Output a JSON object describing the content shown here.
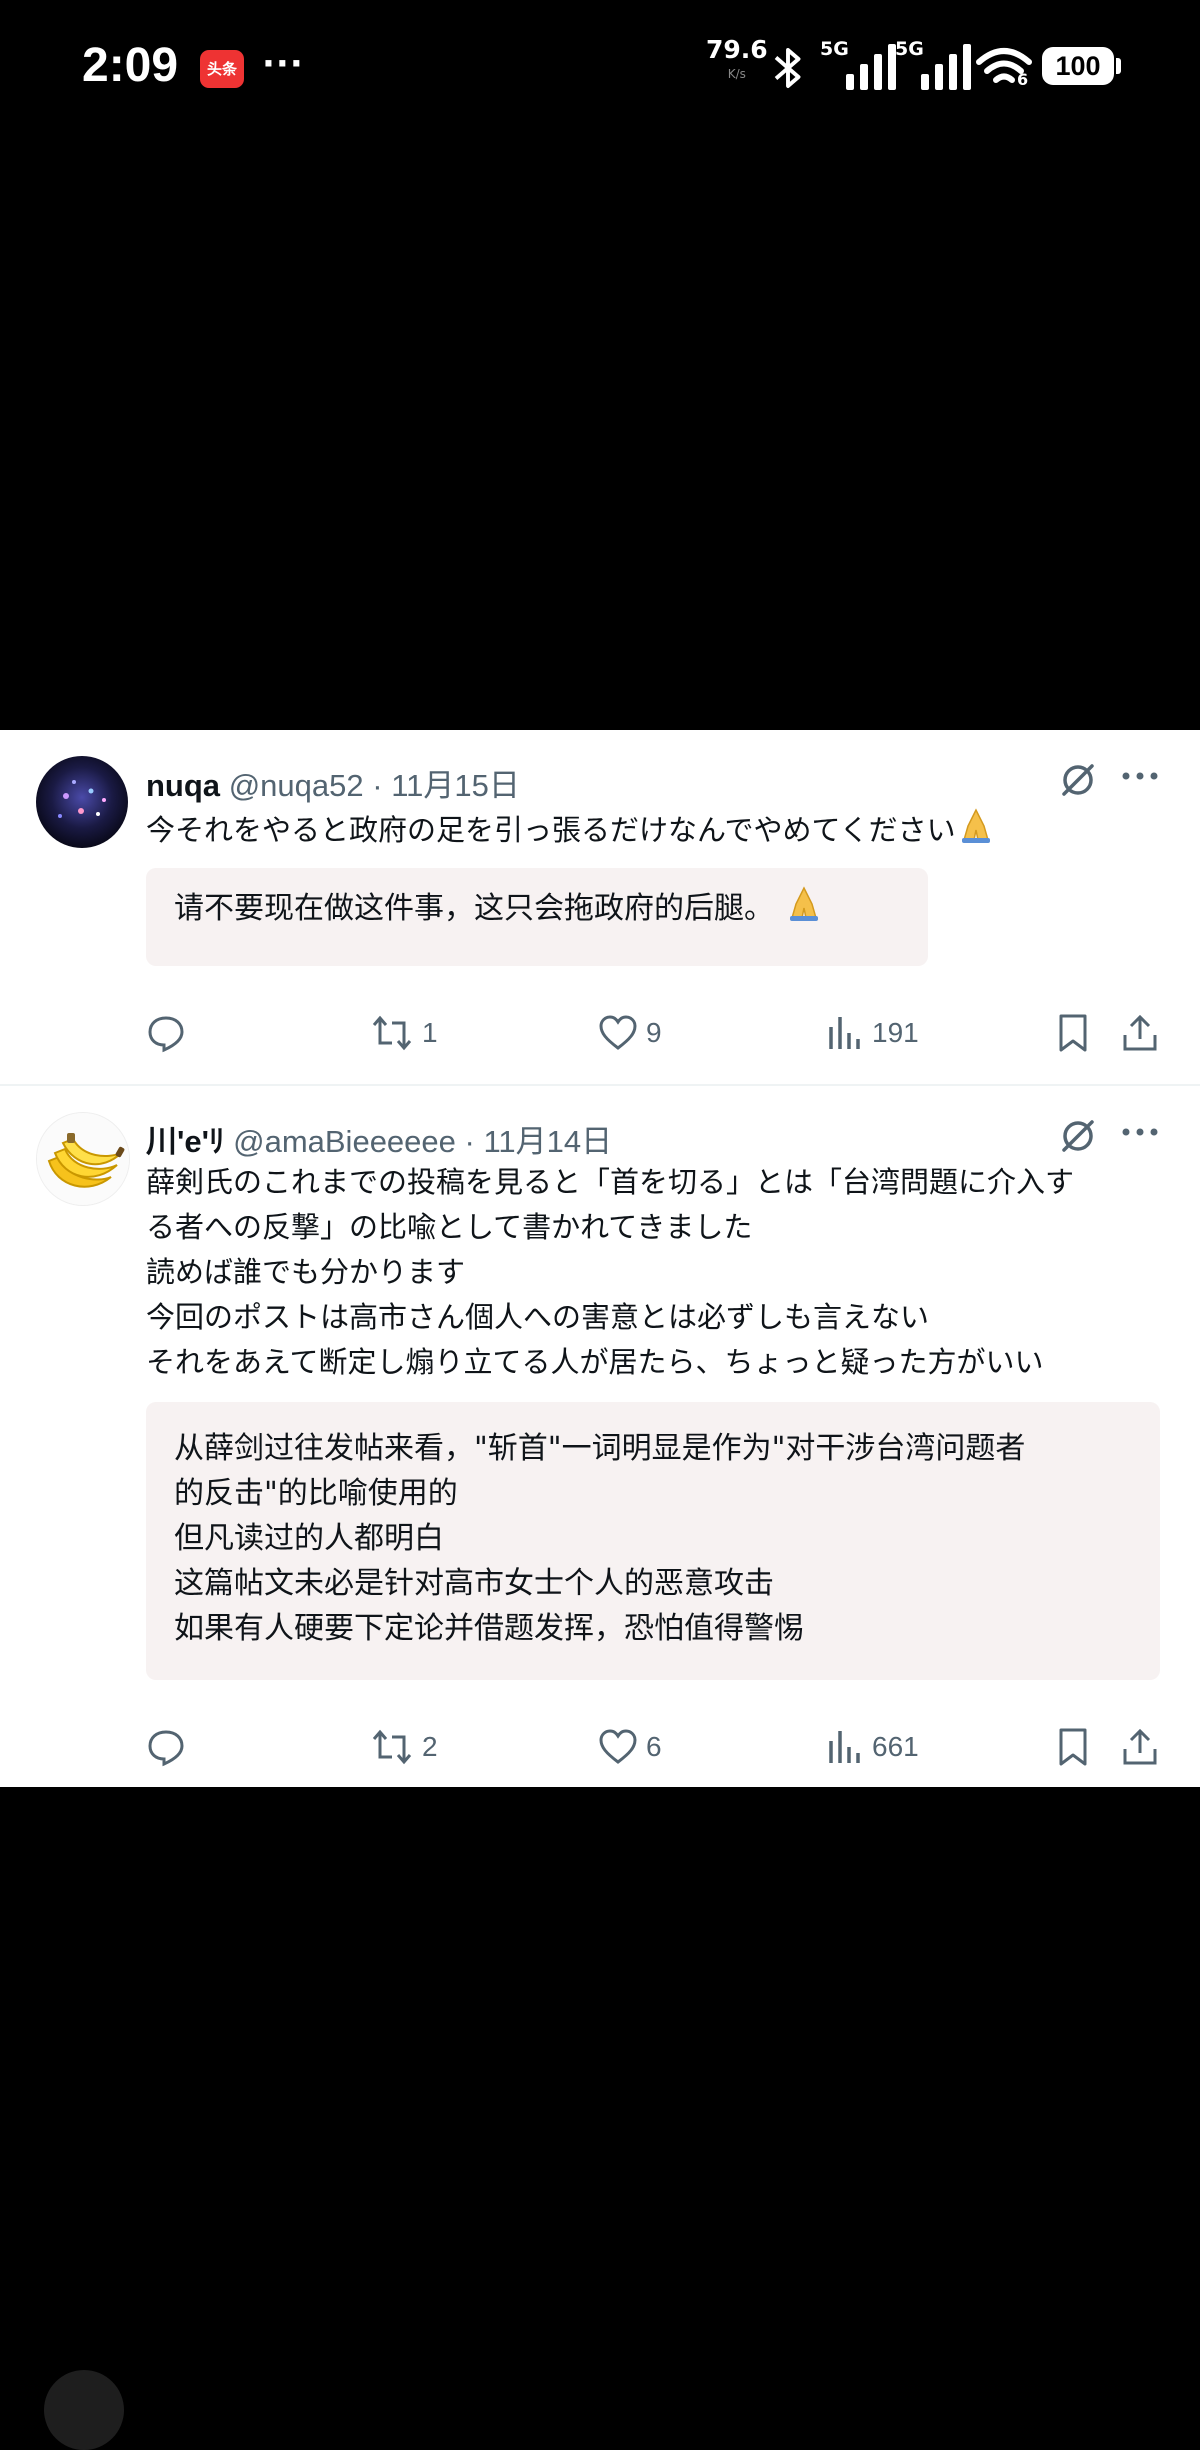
{
  "status_bar": {
    "time": "2:09",
    "app_badge": "头条",
    "dots": "···",
    "net_speed": "79.6",
    "net_speed_unit": "K/s",
    "signal_1": "5G",
    "signal_2": "5G",
    "wifi_label": "6",
    "battery": "100"
  },
  "posts": [
    {
      "name": "nuqa",
      "handle": "@nuqa52",
      "sep": "·",
      "date": "11月15日",
      "body": [
        "今それをやると政府の足を引っ張るだけなんでやめてください"
      ],
      "translation": [
        "请不要现在做这件事，这只会拖政府的后腿。"
      ],
      "replies": "",
      "reposts": "1",
      "likes": "9",
      "views": "191"
    },
    {
      "name": "川'e'ﾘ",
      "handle": "@amaBieeeeee",
      "sep": "·",
      "date": "11月14日",
      "body": [
        "薛剣氏のこれまでの投稿を見ると「首を切る」とは「台湾問題に介入す",
        "る者への反撃」の比喩として書かれてきました",
        "読めば誰でも分かります",
        "今回のポストは高市さん個人への害意とは必ずしも言えない",
        "それをあえて断定し煽り立てる人が居たら、ちょっと疑った方がいい"
      ],
      "translation": [
        "从薛剑过往发帖来看，\"斩首\"一词明显是作为\"对干涉台湾问题者",
        "的反击\"的比喻使用的",
        "但凡读过的人都明白",
        "这篇帖文未必是针对高市女士个人的恶意攻击",
        "如果有人硬要下定论并借题发挥，恐怕值得警惕"
      ],
      "replies": "",
      "reposts": "2",
      "likes": "6",
      "views": "661"
    }
  ],
  "colors": {
    "background": "#000000",
    "card": "#ffffff",
    "text": "#0f1419",
    "muted": "#536471",
    "translation_bg": "#f7f2f2"
  },
  "icons": [
    "reply-icon",
    "repost-icon",
    "like-icon",
    "views-icon",
    "bookmark-icon",
    "share-icon",
    "grok-icon",
    "more-icon",
    "folded-hands-emoji"
  ]
}
